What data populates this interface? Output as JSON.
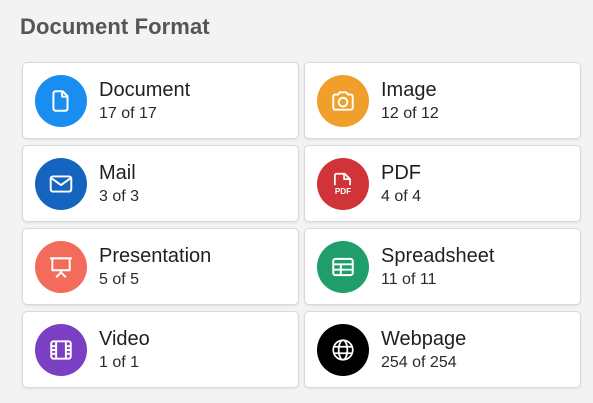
{
  "section": {
    "title": "Document Format"
  },
  "cards": [
    {
      "label": "Document",
      "count": "17 of 17",
      "icon": "document-icon",
      "color": "#1a8ef0"
    },
    {
      "label": "Image",
      "count": "12 of 12",
      "icon": "camera-icon",
      "color": "#f0a02a"
    },
    {
      "label": "Mail",
      "count": "3 of 3",
      "icon": "mail-icon",
      "color": "#1565c0"
    },
    {
      "label": "PDF",
      "count": "4 of 4",
      "icon": "pdf-icon",
      "color": "#d13438"
    },
    {
      "label": "Presentation",
      "count": "5 of 5",
      "icon": "presentation-icon",
      "color": "#f26b5b"
    },
    {
      "label": "Spreadsheet",
      "count": "11 of 11",
      "icon": "spreadsheet-icon",
      "color": "#1f9d6a"
    },
    {
      "label": "Video",
      "count": "1 of 1",
      "icon": "video-icon",
      "color": "#7b3fc4"
    },
    {
      "label": "Webpage",
      "count": "254 of 254",
      "icon": "globe-icon",
      "color": "#000000"
    }
  ],
  "pdf_icon_text": "PDF"
}
